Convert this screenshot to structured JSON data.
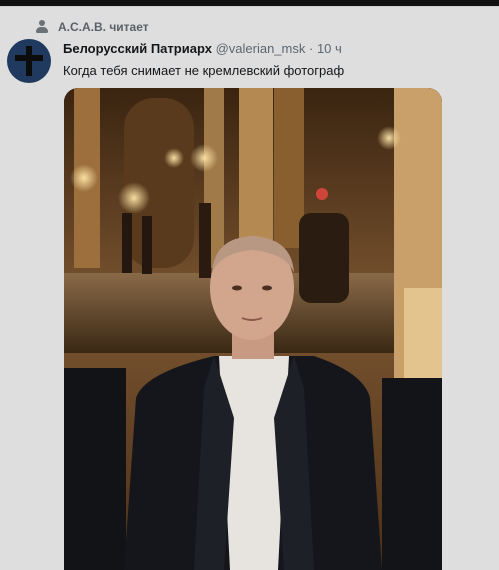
{
  "social_context": {
    "text": "А.С.А.В. читает",
    "icon": "person-icon"
  },
  "tweet": {
    "avatar_icon": "cross-avatar",
    "display_name": "Белорусский Патриарх",
    "handle": "@valerian_msk",
    "separator": "·",
    "time": "10 ч",
    "text": "Когда тебя снимает не кремлевский фотограф"
  },
  "photo": {
    "alt_subject": "man-in-tuxedo-photo"
  },
  "colors": {
    "background": "#dedede",
    "name": "#14171a",
    "muted": "#5b6670",
    "avatar": "#1f3a5e"
  }
}
